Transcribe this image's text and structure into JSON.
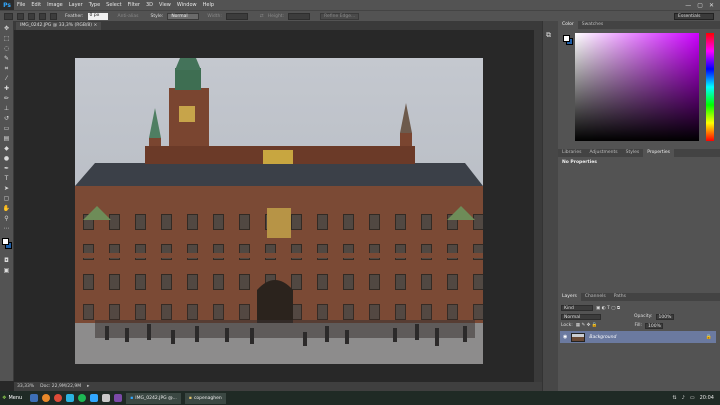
{
  "app": {
    "logo": "Ps",
    "menu": [
      "File",
      "Edit",
      "Image",
      "Layer",
      "Type",
      "Select",
      "Filter",
      "3D",
      "View",
      "Window",
      "Help"
    ],
    "window_controls": [
      "—",
      "▢",
      "✕"
    ]
  },
  "options_bar": {
    "feather_label": "Feather:",
    "feather_value": "0 px",
    "anti_alias_label": "Anti-alias",
    "style_label": "Style:",
    "style_value": "Normal",
    "width_label": "Width:",
    "height_label": "Height:",
    "refine_edge_label": "Refine Edge...",
    "workspace": "Essentials"
  },
  "document": {
    "tab_title": "IMG_0242.JPG @ 33,3% (RGB/8)",
    "zoom": "33,33%",
    "doc_info": "Doc: 22,9M/22,9M"
  },
  "color_panel": {
    "tabs": [
      "Color",
      "Swatches"
    ],
    "gradient_hue": "#cc00ff"
  },
  "properties_panel": {
    "tabs": [
      "Libraries",
      "Adjustments",
      "Styles",
      "Properties"
    ],
    "title": "No Properties"
  },
  "layers_panel": {
    "tabs": [
      "Layers",
      "Channels",
      "Paths"
    ],
    "kind_label": "Kind",
    "blend_mode": "Normal",
    "opacity_label": "Opacity:",
    "opacity_value": "100%",
    "lock_label": "Lock:",
    "fill_label": "Fill:",
    "fill_value": "100%",
    "layers": [
      {
        "name": "Background",
        "locked": true,
        "visible": true
      }
    ]
  },
  "taskbar": {
    "start_label": "Menu",
    "tasks": [
      {
        "label": "IMG_0242.JPG @..."
      },
      {
        "label": "copenaghen"
      }
    ],
    "clock": "20:04"
  },
  "colors": {
    "accent": "#31a8ff",
    "panel": "#535353",
    "layer_selected": "#6b7aa0"
  }
}
